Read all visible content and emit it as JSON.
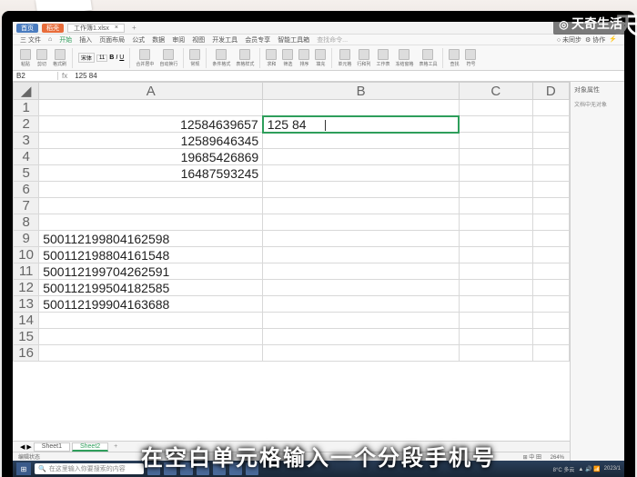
{
  "watermark": {
    "brand": "天奇生活",
    "side": "天"
  },
  "titlebar": {
    "btn1": "首页",
    "btn2": "稻壳",
    "tab": "工作簿1.xlsx"
  },
  "menu": {
    "items": [
      "三 文件",
      "⌂",
      "开始",
      "插入",
      "页面布局",
      "公式",
      "数据",
      "审阅",
      "视图",
      "开发工具",
      "会员专享",
      "智能工具箱"
    ],
    "search": "查找命令...",
    "right": [
      "○ 未同步",
      "⚙ 协作",
      "⚡"
    ]
  },
  "ribbon": {
    "groups": [
      "粘贴",
      "剪切",
      "格式刷",
      "宋体",
      "11",
      "B",
      "I",
      "U",
      "A",
      "田",
      "合并居中",
      "自动换行",
      "常规",
      "条件格式",
      "表格样式",
      "求和",
      "筛选",
      "排序",
      "填充",
      "单元格",
      "行和列",
      "工作表",
      "冻结窗格",
      "表格工具",
      "查找",
      "符号"
    ]
  },
  "formula": {
    "cell_ref": "B2",
    "fx": "fx",
    "value": "125  84"
  },
  "columns": [
    "A",
    "B",
    "C",
    "D"
  ],
  "rows_data": {
    "r2": {
      "A": "12584639657",
      "B": "125  84"
    },
    "r3": {
      "A": "12589646345"
    },
    "r4": {
      "A": "19685426869"
    },
    "r5": {
      "A": "16487593245"
    },
    "r9": {
      "A": "500112199804162598"
    },
    "r10": {
      "A": "500112198804161548"
    },
    "r11": {
      "A": "500112199704262591"
    },
    "r12": {
      "A": "500112199504182585"
    },
    "r13": {
      "A": "500112199904163688"
    }
  },
  "side_panel": {
    "title": "对象属性",
    "sub": "文档中无对象"
  },
  "sheets": {
    "s1": "Sheet1",
    "s2": "Sheet2",
    "add": "+"
  },
  "status": {
    "left": "编辑状态",
    "zoom": "264%",
    "right": "⊞ 中 田"
  },
  "taskbar": {
    "search": "在这里输入你要搜索的内容",
    "weather": "8°C 多云",
    "time": "2023/1"
  },
  "subtitle": "在空白单元格输入一个分段手机号"
}
